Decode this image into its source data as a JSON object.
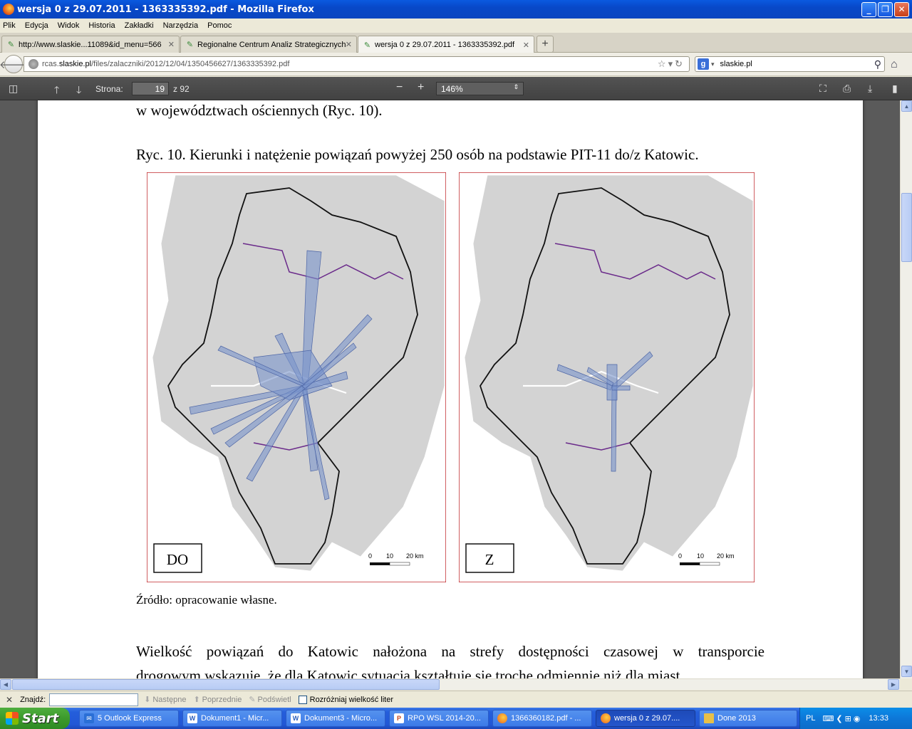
{
  "window": {
    "title": "wersja 0 z 29.07.2011 - 1363335392.pdf - Mozilla Firefox",
    "controls": {
      "minimize": "_",
      "maximize": "❐",
      "close": "✕"
    }
  },
  "menu": [
    "Plik",
    "Edycja",
    "Widok",
    "Historia",
    "Zakładki",
    "Narzędzia",
    "Pomoc"
  ],
  "tabs": [
    {
      "label": "http://www.slaskie...11089&id_menu=566",
      "active": false
    },
    {
      "label": "Regionalne Centrum Analiz Strategicznych",
      "active": false
    },
    {
      "label": "wersja 0 z 29.07.2011 - 1363335392.pdf",
      "active": true
    }
  ],
  "nav": {
    "url_prefix": "rcas.",
    "url_domain": "slaskie.pl",
    "url_path": "/files/zalaczniki/2012/12/04/1350456627/1363335392.pdf",
    "search_engine": "g",
    "search_value": "slaskie.pl"
  },
  "pdf_toolbar": {
    "page_label": "Strona:",
    "page_current": "19",
    "page_total": "z 92",
    "zoom": "146%"
  },
  "document": {
    "line_top": "w województwach ościennych (Ryc. 10).",
    "figure_caption": "Ryc. 10. Kierunki i natężenie powiązań powyżej 250 osób na podstawie PIT-11 do/z Katowic.",
    "map_left_label": "DO",
    "map_right_label": "Z",
    "scale": {
      "t0": "0",
      "t10": "10",
      "t20": "20 km"
    },
    "source": "Źródło: opracowanie własne.",
    "paragraph_line1": "Wielkość powiązań do Katowic nałożona na strefy dostępności czasowej w transporcie",
    "paragraph_line2": "drogowym wskazuje, że dla Katowic sytuacja kształtuje się trochę odmiennie niż dla miast"
  },
  "findbar": {
    "label": "Znajdź:",
    "next": "Następne",
    "prev": "Poprzednie",
    "highlight": "Podświetl",
    "match_case": "Rozróżniaj wielkość liter"
  },
  "taskbar": {
    "start": "Start",
    "items": [
      {
        "label": "5 Outlook Express",
        "icon": "outlook-icon",
        "color": "#2a6fd6"
      },
      {
        "label": "Dokument1 - Micr...",
        "icon": "word-icon",
        "color": "#2b5ebd"
      },
      {
        "label": "Dokument3 - Micro...",
        "icon": "word-icon",
        "color": "#2b5ebd"
      },
      {
        "label": "RPO WSL 2014-20...",
        "icon": "powerpoint-icon",
        "color": "#c8451c"
      },
      {
        "label": "1366360182.pdf - ...",
        "icon": "firefox-icon",
        "color": "#e8601c"
      },
      {
        "label": "wersja 0 z 29.07....",
        "icon": "firefox-icon",
        "color": "#e8601c"
      },
      {
        "label": "Done 2013",
        "icon": "folder-icon",
        "color": "#e8c048"
      }
    ],
    "lang": "PL",
    "clock": "13:33"
  }
}
